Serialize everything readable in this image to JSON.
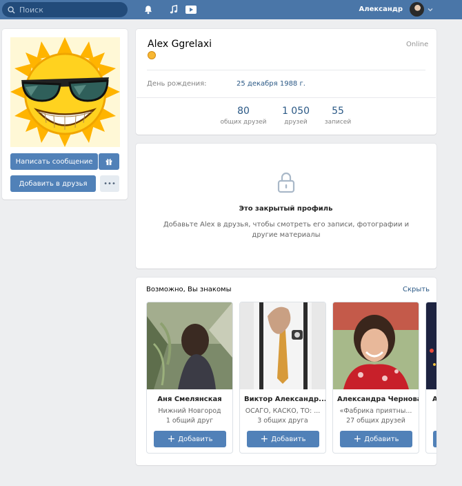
{
  "header": {
    "search_placeholder": "Поиск",
    "user_name": "Александр"
  },
  "left": {
    "message_button": "Написать сообщение",
    "add_friend_button": "Добавить в друзья",
    "more_button": "•••"
  },
  "profile": {
    "name": "Alex Ggrelaxi",
    "status": "Online",
    "birthday_label": "День рождения:",
    "birthday_value": "25 декабря 1988 г.",
    "counters": [
      {
        "value": "80",
        "label": "общих друзей"
      },
      {
        "value": "1 050",
        "label": "друзей"
      },
      {
        "value": "55",
        "label": "записей"
      }
    ]
  },
  "closed_profile": {
    "title": "Это закрытый профиль",
    "text": "Добавьте Alex в друзья, чтобы смотреть его записи, фотографии и другие материалы"
  },
  "suggestions": {
    "title": "Возможно, Вы знакомы",
    "hide_label": "Скрыть",
    "add_label": "Добавить",
    "people": [
      {
        "name": "Аня Смелянская",
        "line1": "Нижний Новгород",
        "line2": "1 общий друг"
      },
      {
        "name": "Виктор Александр...",
        "line1": "ОСАГО, КАСКО, ТО: ...",
        "line2": "3 общих друга"
      },
      {
        "name": "Александра Чернова",
        "line1": "«Фабрика приятны...",
        "line2": "27 общих друзей"
      },
      {
        "name": "А",
        "line1": "",
        "line2": ""
      }
    ]
  },
  "colors": {
    "header_bg": "#4a76a8",
    "accent": "#5181b8",
    "link": "#2a5885",
    "page_bg": "#edeef0"
  }
}
